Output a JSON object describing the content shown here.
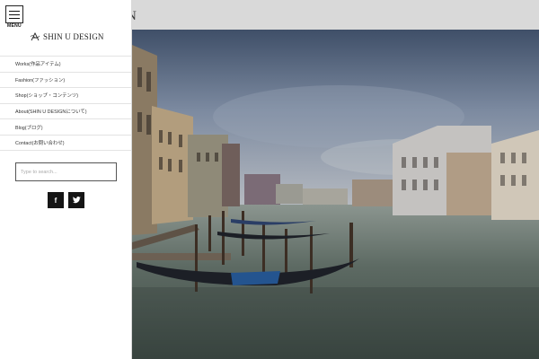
{
  "header": {
    "site_name_partial": "N"
  },
  "sidebar": {
    "menu_label": "MENU",
    "brand_name": "SHIN U DESIGN",
    "nav": [
      {
        "label": "Works(作品アイテム)"
      },
      {
        "label": "Fashion(ファッション)"
      },
      {
        "label": "Shop(ショップ・コンテンツ)"
      },
      {
        "label": "About(SHIN U DESIGNについて)"
      },
      {
        "label": "Blog(ブログ)"
      },
      {
        "label": "Contact(お問い合わせ)"
      }
    ],
    "search_placeholder": "Type to search...",
    "social": [
      {
        "name": "facebook",
        "glyph": "f"
      },
      {
        "name": "twitter",
        "glyph": "t"
      }
    ]
  },
  "colors": {
    "sidebar_bg": "#ffffff",
    "social_bg": "#151515",
    "water": "#55635d",
    "sky": "#7f8fa1"
  }
}
